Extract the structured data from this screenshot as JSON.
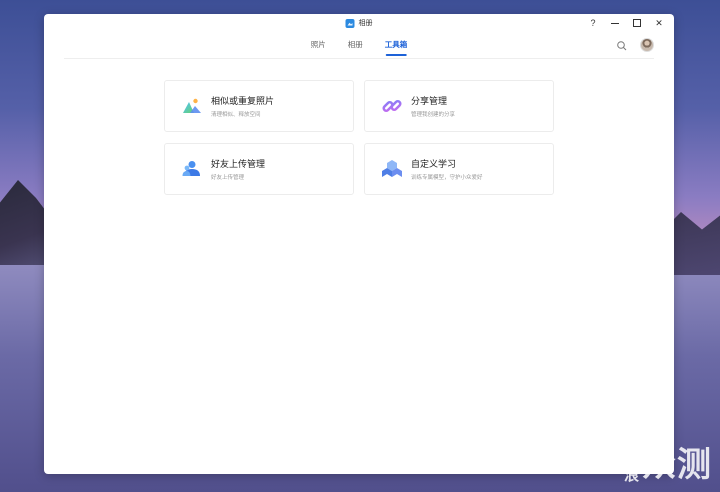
{
  "window": {
    "app_title": "相册",
    "controls": {
      "help": "?",
      "close": "✕"
    }
  },
  "nav": {
    "tabs": [
      {
        "label": "照片",
        "active": false
      },
      {
        "label": "相册",
        "active": false
      },
      {
        "label": "工具箱",
        "active": true
      }
    ]
  },
  "tools": [
    {
      "title": "相似或重复照片",
      "subtitle": "清理相似、释放空间",
      "icon": "landscape-icon"
    },
    {
      "title": "分享管理",
      "subtitle": "管理我创建的分享",
      "icon": "link-icon"
    },
    {
      "title": "好友上传管理",
      "subtitle": "好友上传管理",
      "icon": "friends-upload-icon"
    },
    {
      "title": "自定义学习",
      "subtitle": "训练专属模型，守护小众爱好",
      "icon": "cubes-icon"
    }
  ],
  "watermark": {
    "left": "新浪",
    "right": "众测"
  },
  "colors": {
    "accent": "#1d62d8",
    "app_icon": "#2b8ae0"
  }
}
